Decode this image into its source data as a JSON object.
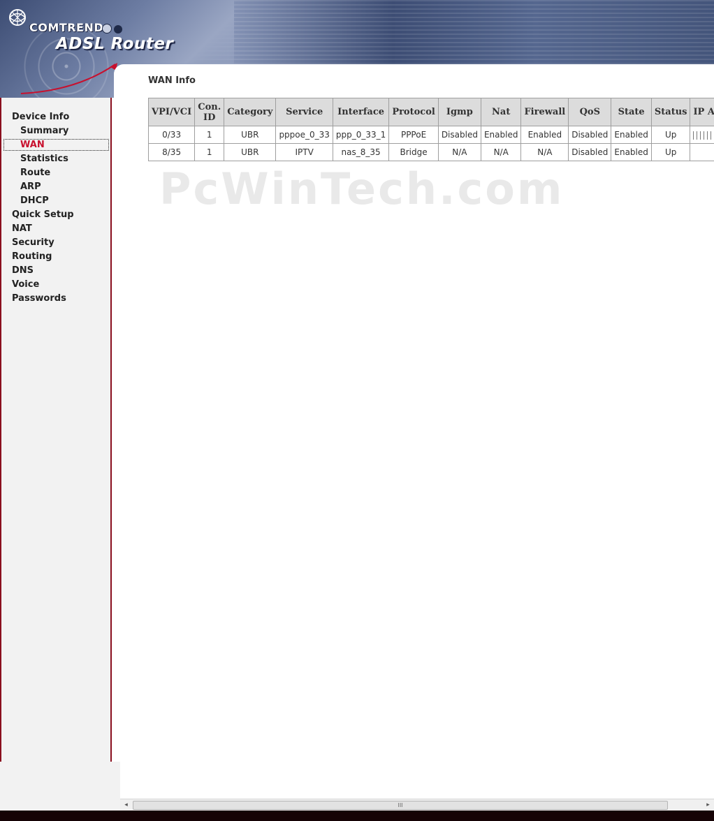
{
  "header": {
    "brand": "COMTREND",
    "product": "ADSL Router",
    "colors": {
      "banner": "#3d4d74",
      "dot_dark": "#1f2a48",
      "dot_light": "#c9d0e2",
      "swoosh": "#c8102e"
    }
  },
  "sidebar": {
    "active_color": "#c8102e",
    "items": [
      {
        "label": "Device Info",
        "level": 1
      },
      {
        "label": "Summary",
        "level": 2
      },
      {
        "label": "WAN",
        "level": 2,
        "active": true
      },
      {
        "label": "Statistics",
        "level": 2
      },
      {
        "label": "Route",
        "level": 2
      },
      {
        "label": "ARP",
        "level": 2
      },
      {
        "label": "DHCP",
        "level": 2
      },
      {
        "label": "Quick Setup",
        "level": 1
      },
      {
        "label": "NAT",
        "level": 1
      },
      {
        "label": "Security",
        "level": 1
      },
      {
        "label": "Routing",
        "level": 1
      },
      {
        "label": "DNS",
        "level": 1
      },
      {
        "label": "Voice",
        "level": 1
      },
      {
        "label": "Passwords",
        "level": 1
      }
    ]
  },
  "main": {
    "title": "WAN Info",
    "table": {
      "headers": [
        "VPI/VCI",
        "Con. ID",
        "Category",
        "Service",
        "Interface",
        "Protocol",
        "Igmp",
        "Nat",
        "Firewall",
        "QoS",
        "State",
        "Status",
        "IP Address"
      ],
      "rows": [
        [
          "0/33",
          "1",
          "UBR",
          "pppoe_0_33",
          "ppp_0_33_1",
          "PPPoE",
          "Disabled",
          "Enabled",
          "Enabled",
          "Disabled",
          "Enabled",
          "Up",
          ""
        ],
        [
          "8/35",
          "1",
          "UBR",
          "IPTV",
          "nas_8_35",
          "Bridge",
          "N/A",
          "N/A",
          "N/A",
          "Disabled",
          "Enabled",
          "Up",
          ""
        ]
      ]
    },
    "watermark": "PcWinTech.com"
  },
  "scrollbar": {
    "left_arrow": "◂",
    "right_arrow": "▸",
    "thumb_grip": "III"
  }
}
